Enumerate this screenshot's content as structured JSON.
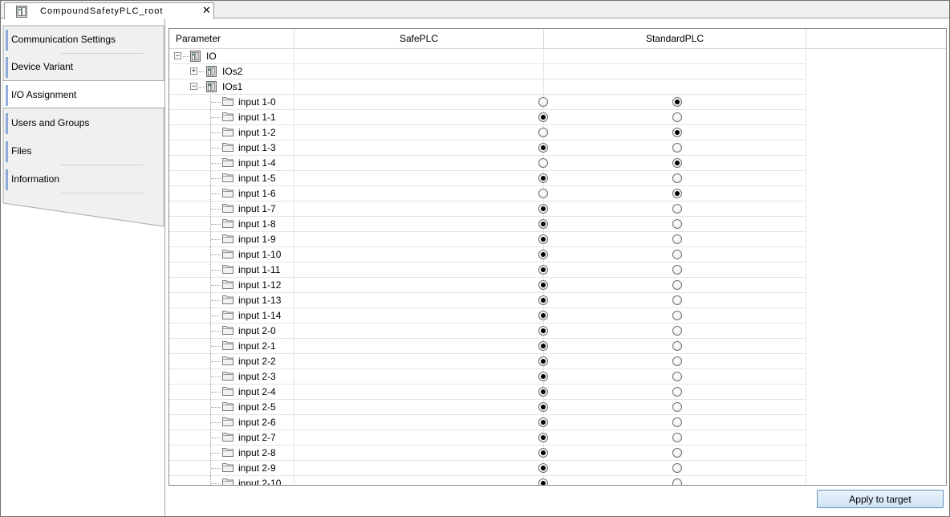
{
  "document_tab": {
    "title": "CompoundSafetyPLC_root",
    "close_label": "✕",
    "icon": "plc-device-icon"
  },
  "side_tabs": [
    {
      "label": "Communication Settings",
      "active": false
    },
    {
      "label": "Device Variant",
      "active": false
    },
    {
      "label": "I/O Assignment",
      "active": true
    },
    {
      "label": "Users and Groups",
      "active": false
    },
    {
      "label": "Files",
      "active": false
    },
    {
      "label": "Information",
      "active": false
    }
  ],
  "grid": {
    "columns": [
      "Parameter",
      "SafePLC",
      "StandardPLC"
    ],
    "tree_nodes": [
      {
        "label": "IO",
        "expander": "−"
      },
      {
        "label": "IOs2",
        "expander": "+"
      },
      {
        "label": "IOs1",
        "expander": "−"
      }
    ],
    "inputs": [
      {
        "label": "input 1-0",
        "assignment": "StandardPLC"
      },
      {
        "label": "input 1-1",
        "assignment": "SafePLC"
      },
      {
        "label": "input 1-2",
        "assignment": "StandardPLC"
      },
      {
        "label": "input 1-3",
        "assignment": "SafePLC"
      },
      {
        "label": "input 1-4",
        "assignment": "StandardPLC"
      },
      {
        "label": "input 1-5",
        "assignment": "SafePLC"
      },
      {
        "label": "input 1-6",
        "assignment": "StandardPLC"
      },
      {
        "label": "input 1-7",
        "assignment": "SafePLC"
      },
      {
        "label": "input 1-8",
        "assignment": "SafePLC"
      },
      {
        "label": "input 1-9",
        "assignment": "SafePLC"
      },
      {
        "label": "input 1-10",
        "assignment": "SafePLC"
      },
      {
        "label": "input 1-11",
        "assignment": "SafePLC"
      },
      {
        "label": "input 1-12",
        "assignment": "SafePLC"
      },
      {
        "label": "input 1-13",
        "assignment": "SafePLC"
      },
      {
        "label": "input 1-14",
        "assignment": "SafePLC"
      },
      {
        "label": "input 2-0",
        "assignment": "SafePLC"
      },
      {
        "label": "input 2-1",
        "assignment": "SafePLC"
      },
      {
        "label": "input 2-2",
        "assignment": "SafePLC"
      },
      {
        "label": "input 2-3",
        "assignment": "SafePLC"
      },
      {
        "label": "input 2-4",
        "assignment": "SafePLC"
      },
      {
        "label": "input 2-5",
        "assignment": "SafePLC"
      },
      {
        "label": "input 2-6",
        "assignment": "SafePLC"
      },
      {
        "label": "input 2-7",
        "assignment": "SafePLC"
      },
      {
        "label": "input 2-8",
        "assignment": "SafePLC"
      },
      {
        "label": "input 2-9",
        "assignment": "SafePLC"
      },
      {
        "label": "input 2-10",
        "assignment": "SafePLC"
      }
    ]
  },
  "apply_button": {
    "label": "Apply to target"
  },
  "colors": {
    "accent": "#4a7bbf",
    "button_border": "#5f8fc0",
    "tab_bg": "#f0f0f0"
  }
}
